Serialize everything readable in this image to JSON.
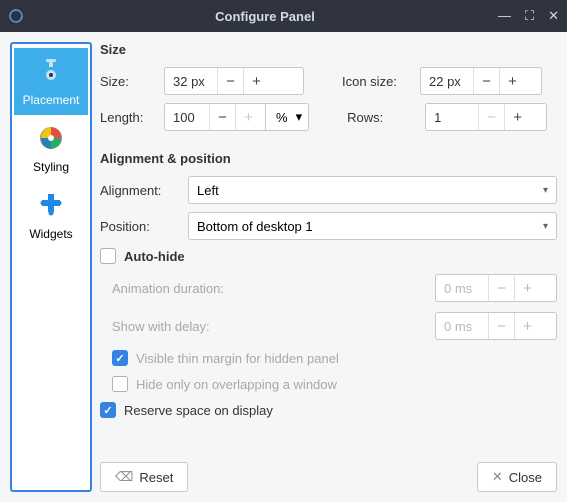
{
  "window": {
    "title": "Configure Panel"
  },
  "sidebar": {
    "items": [
      {
        "label": "Placement"
      },
      {
        "label": "Styling"
      },
      {
        "label": "Widgets"
      }
    ]
  },
  "size": {
    "heading": "Size",
    "size_label": "Size:",
    "size_value": "32 px",
    "length_label": "Length:",
    "length_value": "100",
    "length_unit": "%",
    "icon_label": "Icon size:",
    "icon_value": "22 px",
    "rows_label": "Rows:",
    "rows_value": "1"
  },
  "align": {
    "heading": "Alignment & position",
    "alignment_label": "Alignment:",
    "alignment_value": "Left",
    "position_label": "Position:",
    "position_value": "Bottom of desktop 1",
    "autohide_label": "Auto-hide",
    "anim_label": "Animation duration:",
    "anim_value": "0 ms",
    "delay_label": "Show with delay:",
    "delay_value": "0 ms",
    "margin_label": "Visible thin margin for hidden panel",
    "overlap_label": "Hide only on overlapping a window",
    "reserve_label": "Reserve space on display"
  },
  "footer": {
    "reset": "Reset",
    "close": "Close"
  }
}
